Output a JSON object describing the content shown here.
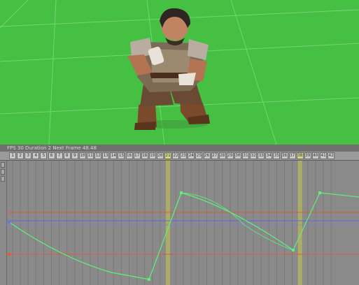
{
  "viewport": {
    "background_color": "#45c043",
    "character": "dwarf-character-model"
  },
  "timeline": {
    "info_text": "FPS 30  Duration 2  Next Frame 48.48",
    "frames": [
      "1",
      "2",
      "3",
      "4",
      "5",
      "6",
      "7",
      "8",
      "9",
      "10",
      "11",
      "12",
      "13",
      "14",
      "15",
      "16",
      "17",
      "18",
      "19",
      "20",
      "21",
      "22",
      "23",
      "24",
      "25",
      "26",
      "27",
      "28",
      "29",
      "30",
      "31",
      "32",
      "33",
      "34",
      "35",
      "36",
      "37",
      "38",
      "39",
      "40",
      "41",
      "42"
    ],
    "keyframes": [
      "21",
      "38"
    ],
    "curve_colors": {
      "red": "#e05a3c",
      "blue": "#5a66e8",
      "green": "#5ef07a",
      "keyframe_marker": "#b5b55c"
    }
  }
}
